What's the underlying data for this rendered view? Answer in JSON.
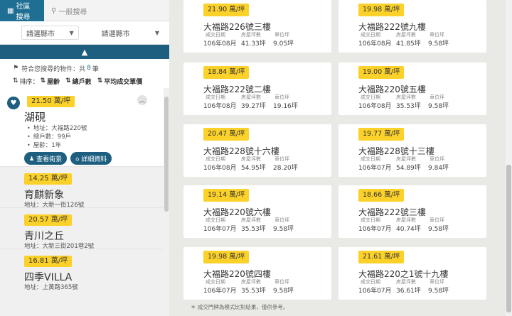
{
  "sidebar": {
    "tabs": [
      {
        "label": "社區搜尋",
        "icon": "building-icon"
      },
      {
        "label": "一般搜尋",
        "icon": "search-icon"
      }
    ],
    "filters": {
      "county": "請選縣市",
      "district": "請選縣市"
    },
    "summary": {
      "prefix": "符合您搜尋的物件：共",
      "count": "8",
      "suffix": "筆"
    },
    "sort": {
      "label": "排序：",
      "options": [
        "屋齡",
        "總戶數",
        "平均成交單價"
      ]
    },
    "selected": {
      "price": "21.50 萬/坪",
      "name": "湖硯",
      "details": [
        "地址：大福路220號",
        "總戶數：99戶",
        "屋齡：1年"
      ],
      "buttons": [
        "查看街景",
        "詳細資料"
      ]
    },
    "items": [
      {
        "price": "14.25 萬/坪",
        "name": "育麒新象",
        "addr": "地址：大新一街126號"
      },
      {
        "price": "20.57 萬/坪",
        "name": "青川之丘",
        "addr": "地址：大新三街201巷2號"
      },
      {
        "price": "16.81 萬/坪",
        "name": "四季VILLA",
        "addr": "地址：上黃路365號"
      }
    ]
  },
  "labels": {
    "date": "成交日期",
    "area": "房屋坪數",
    "parking": "車位坪"
  },
  "cards": [
    {
      "price": "21.90 萬/坪",
      "name": "大福路226號三樓",
      "date": "106年08月",
      "area": "41.33坪",
      "parking": "9.05坪"
    },
    {
      "price": "19.98 萬/坪",
      "name": "大福路222號九樓",
      "date": "106年08月",
      "area": "41.85坪",
      "parking": "9.58坪"
    },
    {
      "price": "18.84 萬/坪",
      "name": "大福路222號二樓",
      "date": "106年08月",
      "area": "39.27坪",
      "parking": "19.16坪"
    },
    {
      "price": "19.00 萬/坪",
      "name": "大福路220號五樓",
      "date": "106年08月",
      "area": "35.53坪",
      "parking": "9.58坪"
    },
    {
      "price": "20.47 萬/坪",
      "name": "大福路228號十六樓",
      "date": "106年08月",
      "area": "54.95坪",
      "parking": "28.20坪"
    },
    {
      "price": "19.77 萬/坪",
      "name": "大福路228號十三樓",
      "date": "106年07月",
      "area": "54.89坪",
      "parking": "9.84坪"
    },
    {
      "price": "19.14 萬/坪",
      "name": "大福路220號六樓",
      "date": "106年07月",
      "area": "35.53坪",
      "parking": "9.58坪"
    },
    {
      "price": "18.66 萬/坪",
      "name": "大福路222號三樓",
      "date": "106年07月",
      "area": "40.74坪",
      "parking": "9.58坪"
    },
    {
      "price": "19.98 萬/坪",
      "name": "大福路220號四樓",
      "date": "106年07月",
      "area": "35.53坪",
      "parking": "9.58坪"
    },
    {
      "price": "21.61 萬/坪",
      "name": "大福路220之1號十九樓",
      "date": "106年07月",
      "area": "36.61坪",
      "parking": "9.58坪"
    }
  ],
  "footnote": "＊ 成交門牌為模式比對結果，僅供參考。"
}
